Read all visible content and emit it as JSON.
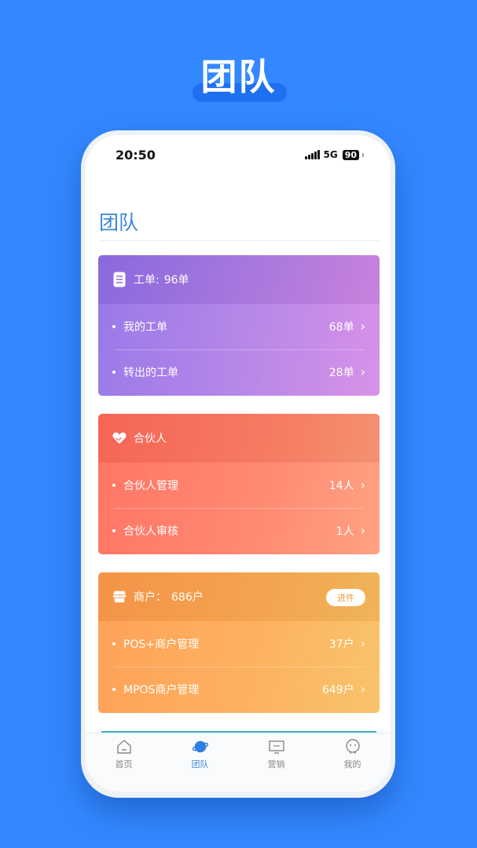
{
  "hero": {
    "title": "团队"
  },
  "status": {
    "time": "20:50",
    "network": "5G",
    "battery": "90"
  },
  "page": {
    "title": "团队"
  },
  "cards": [
    {
      "icon": "document-icon",
      "title": "工单:",
      "count": "96单",
      "rows": [
        {
          "label": "我的工单",
          "value": "68单"
        },
        {
          "label": "转出的工单",
          "value": "28单"
        }
      ]
    },
    {
      "icon": "handshake-heart-icon",
      "title": "合伙人",
      "rows": [
        {
          "label": "合伙人管理",
          "value": "14人"
        },
        {
          "label": "合伙人审核",
          "value": "1人"
        }
      ]
    },
    {
      "icon": "store-icon",
      "title": "商户：",
      "count": "686户",
      "action": "进件",
      "rows": [
        {
          "label": "POS+商户管理",
          "value": "37户"
        },
        {
          "label": "MPOS商户管理",
          "value": "649户"
        }
      ]
    }
  ],
  "tabbar": {
    "items": [
      {
        "label": "首页",
        "icon": "home-icon"
      },
      {
        "label": "团队",
        "icon": "planet-icon",
        "active": true
      },
      {
        "label": "营销",
        "icon": "monitor-icon"
      },
      {
        "label": "我的",
        "icon": "face-icon"
      }
    ]
  },
  "colors": {
    "background": "#3388ff",
    "accent": "#3a86d6"
  }
}
